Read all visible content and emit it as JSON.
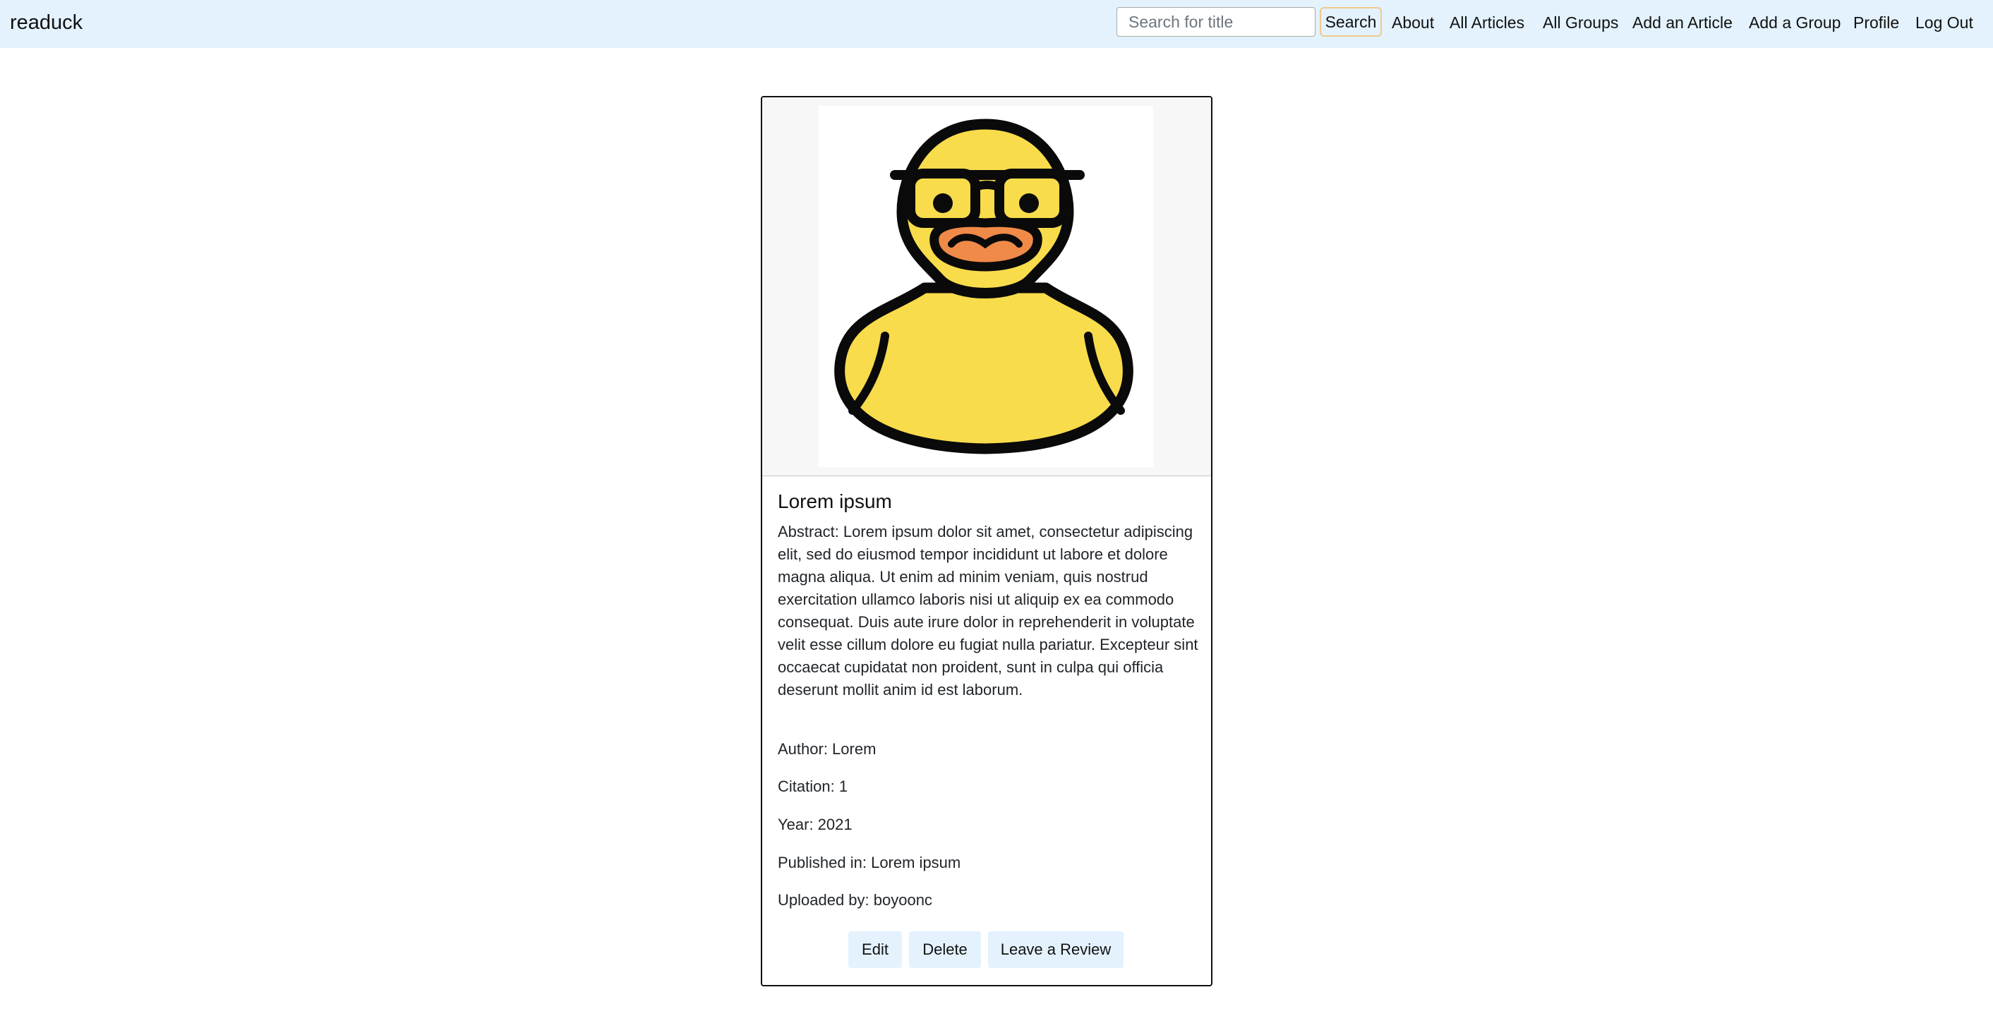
{
  "navbar": {
    "brand": "readuck",
    "search": {
      "placeholder": "Search for title",
      "value": "",
      "button_label": "Search"
    },
    "links": [
      "About",
      "All Articles",
      "All Groups",
      "Add an Article",
      "Add a Group",
      "Profile",
      "Log Out"
    ]
  },
  "article": {
    "image_icon": "rubber-duck-with-glasses-icon",
    "title": "Lorem ipsum",
    "abstract": "Abstract: Lorem ipsum dolor sit amet, consectetur adipiscing elit, sed do eiusmod tempor incididunt ut labore et dolore magna aliqua. Ut enim ad minim veniam, quis nostrud exercitation ullamco laboris nisi ut aliquip ex ea commodo consequat. Duis aute irure dolor in reprehenderit in voluptate velit esse cillum dolore eu fugiat nulla pariatur. Excepteur sint occaecat cupidatat non proident, sunt in culpa qui officia deserunt mollit anim id est laborum.",
    "author": "Author: Lorem",
    "citation": "Citation: 1",
    "year": "Year: 2021",
    "published_in": "Published in: Lorem ipsum",
    "uploaded_by": "Uploaded by: boyoonc",
    "actions": {
      "edit": "Edit",
      "delete": "Delete",
      "review": "Leave a Review"
    }
  },
  "colors": {
    "navbar_bg": "#e3f2fd",
    "duck_yellow": "#f8dc4b",
    "duck_beak": "#f08a48",
    "outline": "#0a0a0a"
  }
}
